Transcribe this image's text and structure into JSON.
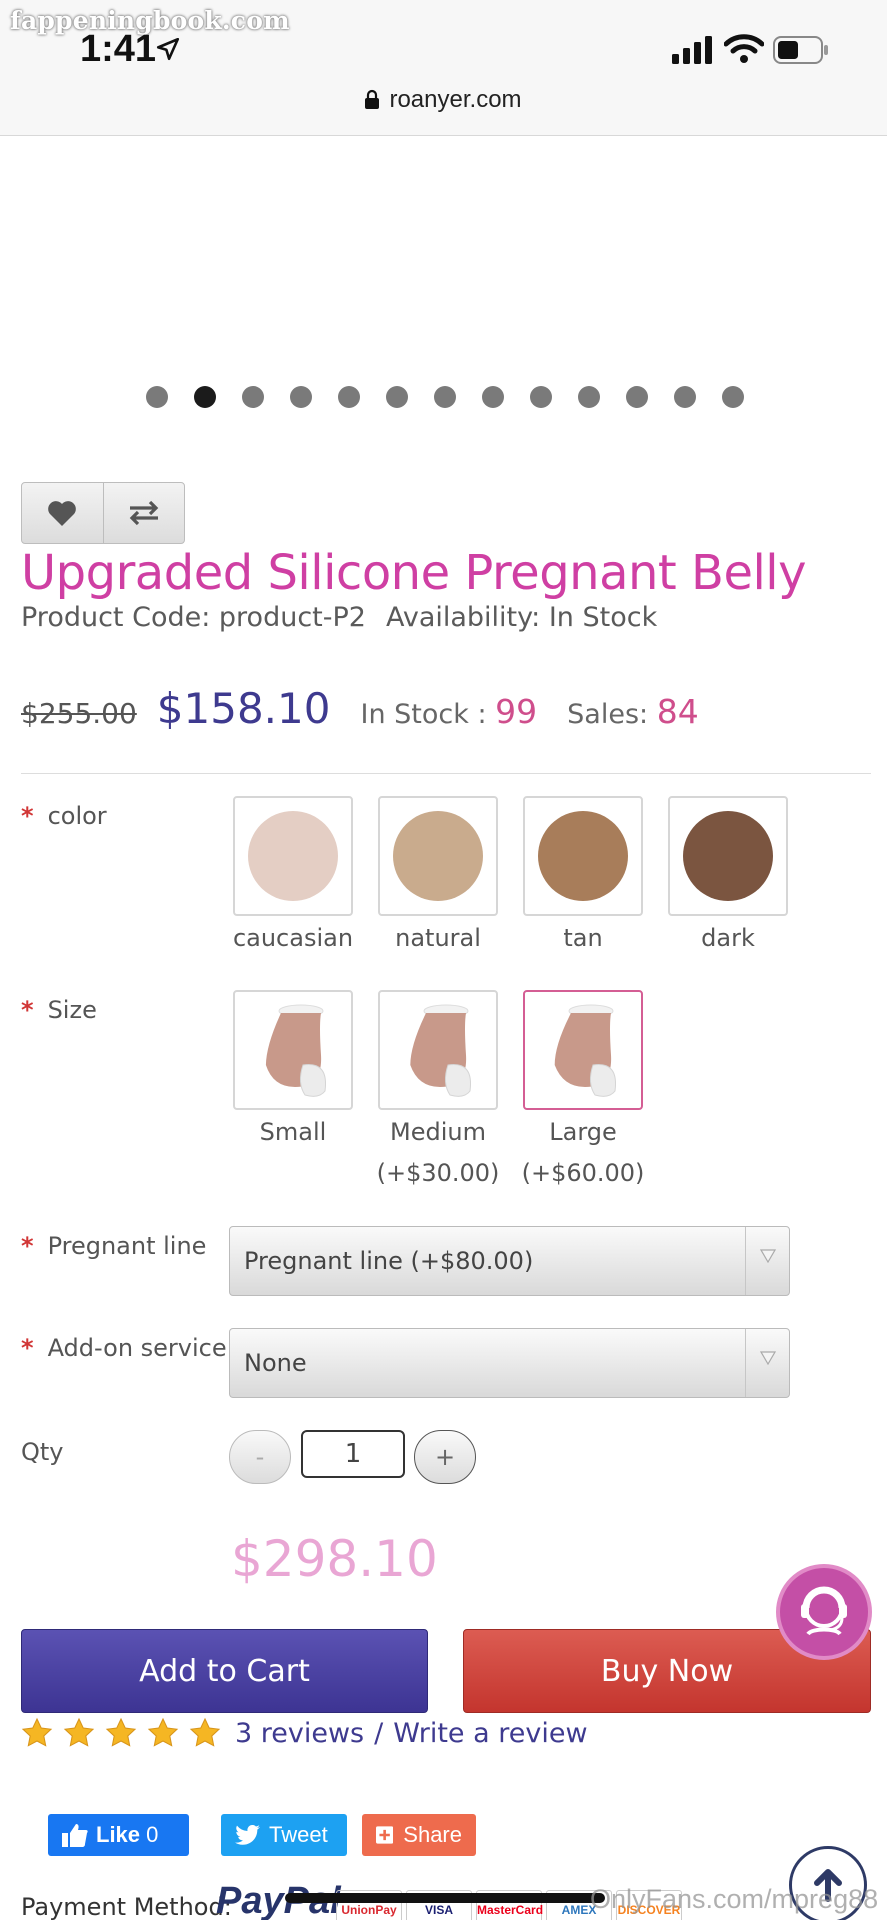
{
  "status_bar": {
    "watermark": "fappeningbook.com",
    "time": "1:41",
    "url": "roanyer.com"
  },
  "carousel": {
    "dot_count": 13,
    "active_index": 1
  },
  "product": {
    "title": "Upgraded Silicone Pregnant Belly",
    "code_label": "Product Code: product-P2",
    "availability_label": "Availability: In Stock",
    "old_price": "$255.00",
    "price": "$158.10",
    "in_stock_label": "In Stock :",
    "in_stock_value": "99",
    "sales_label": "Sales:",
    "sales_value": "84"
  },
  "options": {
    "required_mark": "*",
    "color": {
      "label": "color",
      "swatches": [
        {
          "name": "caucasian",
          "color": "#e4cec4"
        },
        {
          "name": "natural",
          "color": "#c9ab8d"
        },
        {
          "name": "tan",
          "color": "#a87d5a"
        },
        {
          "name": "dark",
          "color": "#7b5540"
        }
      ]
    },
    "size": {
      "label": "Size",
      "items": [
        {
          "name": "Small",
          "extra": ""
        },
        {
          "name": "Medium",
          "extra": "(+$30.00)"
        },
        {
          "name": "Large",
          "extra": "(+$60.00)"
        }
      ],
      "selected": "Large"
    },
    "pregnant_line": {
      "label": "Pregnant line",
      "value": "Pregnant line (+$80.00)"
    },
    "addon_service": {
      "label": "Add-on service",
      "value": "None"
    },
    "qty": {
      "label": "Qty",
      "minus": "-",
      "value": "1",
      "plus": "+"
    }
  },
  "total": "$298.10",
  "buttons": {
    "add_to_cart": "Add to Cart",
    "buy_now": "Buy Now"
  },
  "reviews": {
    "stars": 5,
    "count_label": "3 reviews",
    "separator": "/",
    "write_label": "Write a review"
  },
  "social": {
    "like_label": "Like",
    "like_count": "0",
    "tweet_label": "Tweet",
    "share_label": "Share"
  },
  "payment": {
    "label": "Payment Method:",
    "paypal": "PayPal",
    "cards": [
      "UnionPay",
      "VISA",
      "MasterCard",
      "AMEX",
      "DISCOVER"
    ]
  },
  "overlay_watermark": "OnlyFans.com/mpreg88",
  "colors": {
    "title_pink": "#cf3fa3",
    "price_purple": "#3e3a8f",
    "cart_purple": "#4b43a3",
    "buy_red": "#cf463e"
  }
}
